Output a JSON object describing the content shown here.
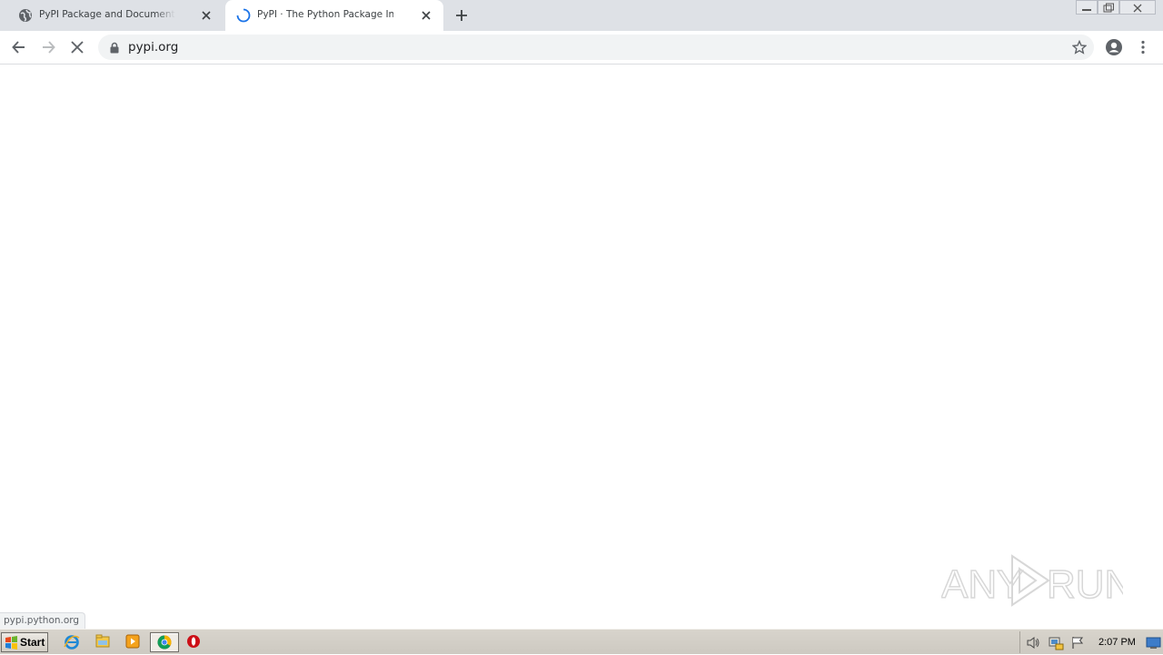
{
  "browser": {
    "tabs": [
      {
        "title": "PyPI Package and Documentation St",
        "state": "inactive",
        "favicon": "globe-icon"
      },
      {
        "title": "PyPI · The Python Package Index",
        "state": "loading",
        "favicon": "loading-spinner-icon"
      }
    ],
    "new_tab_icon": "plus-icon",
    "window_controls": [
      "minimize-icon",
      "restore-icon",
      "close-icon"
    ],
    "toolbar": {
      "back_icon": "arrow-left-icon",
      "forward_icon": "arrow-right-icon",
      "stop_icon": "stop-x-icon",
      "lock_icon": "lock-icon",
      "url": "pypi.org",
      "bookmark_icon": "star-outline-icon",
      "profile_icon": "account-circle-icon",
      "menu_icon": "kebab-menu-icon"
    },
    "status_text": "pypi.python.org"
  },
  "watermark": {
    "text_left": "ANY",
    "text_right": "RUN"
  },
  "taskbar": {
    "start_label": "Start",
    "apps": [
      "ie-icon",
      "explorer-folder-icon",
      "media-player-icon",
      "chrome-icon",
      "opera-icon"
    ],
    "active_app": "chrome-icon",
    "tray_icons": [
      "speaker-icon",
      "network-icon",
      "action-center-flag-icon"
    ],
    "clock": "2:07 PM",
    "show_desktop_icon": "show-desktop-icon"
  },
  "colors": {
    "tabstrip": "#dee1e6",
    "omnibox": "#f1f3f4",
    "spinner": "#1a73e8",
    "taskbar": "#d4d0c8"
  }
}
